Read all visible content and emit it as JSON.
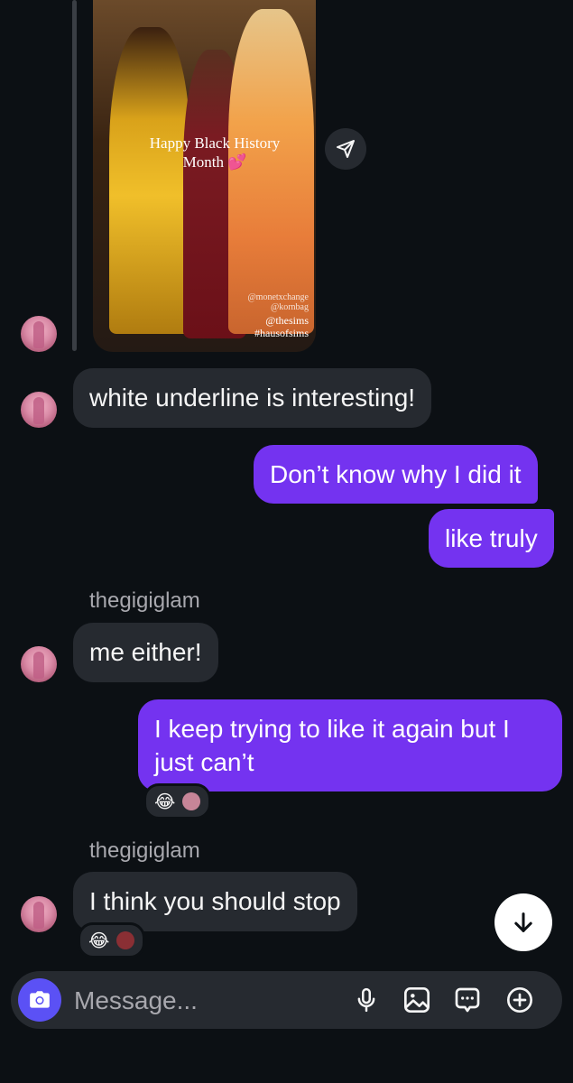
{
  "story": {
    "caption": "Happy Black History Month 💕",
    "credit_small_1": "@monetxchange",
    "credit_small_2": "@kornbag",
    "credit_1": "@thesims",
    "credit_2": "#hausofsims"
  },
  "messages": {
    "m1": "white underline is interesting!",
    "m2": "Don’t know why I did it",
    "m3": "like truly",
    "sender1": "thegigiglam",
    "m4": "me either!",
    "m5": "I keep trying to like it again but I just can’t",
    "sender2": "thegigiglam",
    "m6": "I think you should stop"
  },
  "reactions": {
    "r1_emoji": "😂",
    "r2_emoji": "😂"
  },
  "composer": {
    "placeholder": "Message..."
  },
  "colors": {
    "background": "#0c1014",
    "incoming_bubble": "#262a30",
    "outgoing_bubble": "#7433f0",
    "camera_button": "#5b51f5"
  }
}
